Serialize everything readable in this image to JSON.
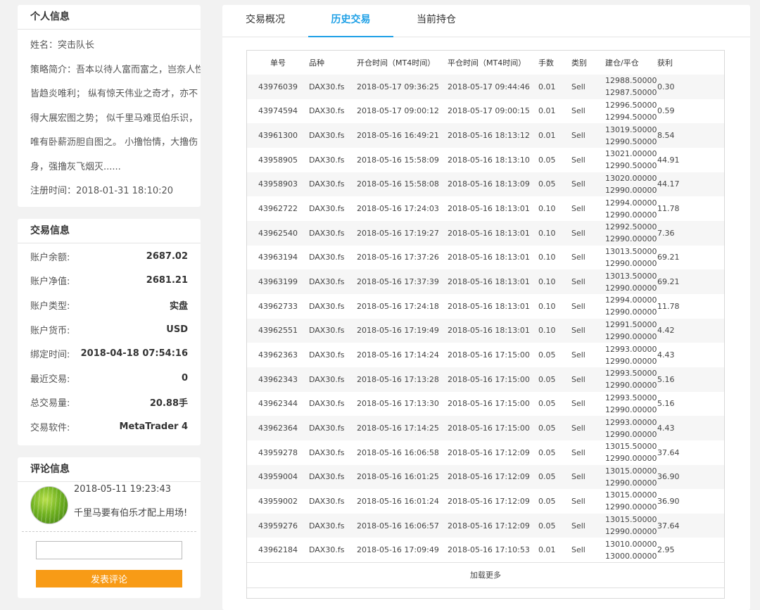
{
  "personal": {
    "title": "个人信息",
    "lines": [
      "姓名：突击队长",
      "策略简介：吾本以待人富而富之，岂奈人性",
      "皆趋炎唯利；  纵有惊天伟业之奇才，亦不",
      "得大展宏图之势；  似千里马难觅伯乐识，",
      "唯有卧薪沥胆自图之。 小撸怡情，大撸伤",
      "身，强撸灰飞烟灭......",
      "注册时间：2018-01-31 18:10:20"
    ]
  },
  "trading": {
    "title": "交易信息",
    "rows": [
      {
        "label": "账户余额:",
        "value": "2687.02"
      },
      {
        "label": "账户净值:",
        "value": "2681.21"
      },
      {
        "label": "账户类型:",
        "value": "实盘"
      },
      {
        "label": "账户货币:",
        "value": "USD"
      },
      {
        "label": "绑定时间:",
        "value": "2018-04-18 07:54:16"
      },
      {
        "label": "最近交易:",
        "value": "0"
      },
      {
        "label": "总交易量:",
        "value": "20.88手"
      },
      {
        "label": "交易软件:",
        "value": "MetaTrader 4"
      }
    ]
  },
  "comments": {
    "title": "评论信息",
    "items": [
      {
        "time": "2018-05-11 19:23:43",
        "text": "千里马要有伯乐才配上用场!"
      }
    ],
    "input_placeholder": "",
    "submit_label": "发表评论"
  },
  "tabs": [
    {
      "label": "交易概况",
      "active": false
    },
    {
      "label": "历史交易",
      "active": true
    },
    {
      "label": "当前持仓",
      "active": false
    }
  ],
  "table": {
    "headers": [
      "单号",
      "品种",
      "开仓时间（MT4时间）",
      "平仓时间（MT4时间）",
      "手数",
      "类别",
      "建仓/平仓",
      "获利"
    ],
    "rows": [
      [
        "43976039",
        "DAX30.fs",
        "2018-05-17 09:36:25",
        "2018-05-17 09:44:46",
        "0.01",
        "Sell",
        "12988.50000",
        "12987.50000",
        "0.30"
      ],
      [
        "43974594",
        "DAX30.fs",
        "2018-05-17 09:00:12",
        "2018-05-17 09:00:15",
        "0.01",
        "Sell",
        "12996.50000",
        "12994.50000",
        "0.59"
      ],
      [
        "43961300",
        "DAX30.fs",
        "2018-05-16 16:49:21",
        "2018-05-16 18:13:12",
        "0.01",
        "Sell",
        "13019.50000",
        "12990.50000",
        "8.54"
      ],
      [
        "43958905",
        "DAX30.fs",
        "2018-05-16 15:58:09",
        "2018-05-16 18:13:10",
        "0.05",
        "Sell",
        "13021.00000",
        "12990.50000",
        "44.91"
      ],
      [
        "43958903",
        "DAX30.fs",
        "2018-05-16 15:58:08",
        "2018-05-16 18:13:09",
        "0.05",
        "Sell",
        "13020.00000",
        "12990.00000",
        "44.17"
      ],
      [
        "43962722",
        "DAX30.fs",
        "2018-05-16 17:24:03",
        "2018-05-16 18:13:01",
        "0.10",
        "Sell",
        "12994.00000",
        "12990.00000",
        "11.78"
      ],
      [
        "43962540",
        "DAX30.fs",
        "2018-05-16 17:19:27",
        "2018-05-16 18:13:01",
        "0.10",
        "Sell",
        "12992.50000",
        "12990.00000",
        "7.36"
      ],
      [
        "43963194",
        "DAX30.fs",
        "2018-05-16 17:37:26",
        "2018-05-16 18:13:01",
        "0.10",
        "Sell",
        "13013.50000",
        "12990.00000",
        "69.21"
      ],
      [
        "43963199",
        "DAX30.fs",
        "2018-05-16 17:37:39",
        "2018-05-16 18:13:01",
        "0.10",
        "Sell",
        "13013.50000",
        "12990.00000",
        "69.21"
      ],
      [
        "43962733",
        "DAX30.fs",
        "2018-05-16 17:24:18",
        "2018-05-16 18:13:01",
        "0.10",
        "Sell",
        "12994.00000",
        "12990.00000",
        "11.78"
      ],
      [
        "43962551",
        "DAX30.fs",
        "2018-05-16 17:19:49",
        "2018-05-16 18:13:01",
        "0.10",
        "Sell",
        "12991.50000",
        "12990.00000",
        "4.42"
      ],
      [
        "43962363",
        "DAX30.fs",
        "2018-05-16 17:14:24",
        "2018-05-16 17:15:00",
        "0.05",
        "Sell",
        "12993.00000",
        "12990.00000",
        "4.43"
      ],
      [
        "43962343",
        "DAX30.fs",
        "2018-05-16 17:13:28",
        "2018-05-16 17:15:00",
        "0.05",
        "Sell",
        "12993.50000",
        "12990.00000",
        "5.16"
      ],
      [
        "43962344",
        "DAX30.fs",
        "2018-05-16 17:13:30",
        "2018-05-16 17:15:00",
        "0.05",
        "Sell",
        "12993.50000",
        "12990.00000",
        "5.16"
      ],
      [
        "43962364",
        "DAX30.fs",
        "2018-05-16 17:14:25",
        "2018-05-16 17:15:00",
        "0.05",
        "Sell",
        "12993.00000",
        "12990.00000",
        "4.43"
      ],
      [
        "43959278",
        "DAX30.fs",
        "2018-05-16 16:06:58",
        "2018-05-16 17:12:09",
        "0.05",
        "Sell",
        "13015.50000",
        "12990.00000",
        "37.64"
      ],
      [
        "43959004",
        "DAX30.fs",
        "2018-05-16 16:01:25",
        "2018-05-16 17:12:09",
        "0.05",
        "Sell",
        "13015.00000",
        "12990.00000",
        "36.90"
      ],
      [
        "43959002",
        "DAX30.fs",
        "2018-05-16 16:01:24",
        "2018-05-16 17:12:09",
        "0.05",
        "Sell",
        "13015.00000",
        "12990.00000",
        "36.90"
      ],
      [
        "43959276",
        "DAX30.fs",
        "2018-05-16 16:06:57",
        "2018-05-16 17:12:09",
        "0.05",
        "Sell",
        "13015.50000",
        "12990.00000",
        "37.64"
      ],
      [
        "43962184",
        "DAX30.fs",
        "2018-05-16 17:09:49",
        "2018-05-16 17:10:53",
        "0.01",
        "Sell",
        "13010.00000",
        "13000.00000",
        "2.95"
      ]
    ],
    "load_more": "加载更多"
  },
  "colors": {
    "accent": "#1ea0e6",
    "button": "#f89b16"
  }
}
